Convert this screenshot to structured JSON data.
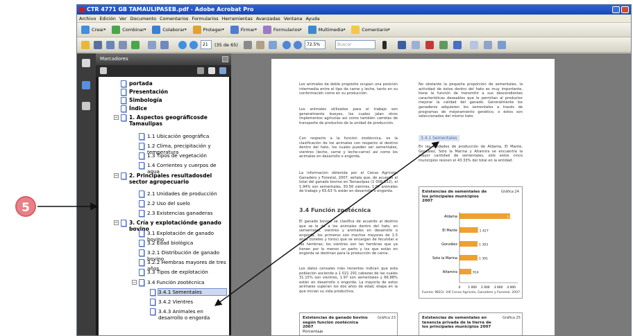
{
  "window": {
    "title": "CTR 4771 GB TAMAULIPASEB.pdf - Adobe Acrobat Pro"
  },
  "menu": [
    "Archivo",
    "Edición",
    "Ver",
    "Documento",
    "Comentarios",
    "Formularios",
    "Herramientas",
    "Avanzadas",
    "Ventana",
    "Ayuda"
  ],
  "toolbar1": [
    {
      "label": "Crear",
      "icon": "create-icon",
      "color": "#3f8fe0"
    },
    {
      "label": "Combinar",
      "icon": "combine-icon",
      "color": "#4aa64a"
    },
    {
      "label": "Colaborar",
      "icon": "collaborate-icon",
      "color": "#3b7fd6"
    },
    {
      "label": "Proteger",
      "icon": "lock-icon",
      "color": "#e2a32c"
    },
    {
      "label": "Firmar",
      "icon": "pen-icon",
      "color": "#4f7bd4"
    },
    {
      "label": "Formularios",
      "icon": "forms-icon",
      "color": "#9b7ac8"
    },
    {
      "label": "Multimedia",
      "icon": "film-icon",
      "color": "#3b8ad2"
    },
    {
      "label": "Comentario",
      "icon": "comment-icon",
      "color": "#f3c93f"
    }
  ],
  "toolbar2": {
    "page_current": "21",
    "page_total": "(35 de 65)",
    "zoom": "72.5%",
    "search_placeholder": "Buscar"
  },
  "bookmarks": {
    "header": "Marcadores",
    "items": [
      {
        "label": "portada",
        "bold": true,
        "level": 0
      },
      {
        "label": "Presentación",
        "bold": true,
        "level": 0
      },
      {
        "label": "Simbología",
        "bold": true,
        "level": 0
      },
      {
        "label": "Índice",
        "bold": true,
        "level": 0
      },
      {
        "label": "1. Aspectos geográficosde Tamaulipas",
        "bold": true,
        "level": 0,
        "expander": "−"
      },
      {
        "label": "1.1 Ubicación geográfica",
        "bold": false,
        "level": 1
      },
      {
        "label": "1.2 Clima, precipitación y temperatura",
        "bold": false,
        "level": 1
      },
      {
        "label": "1.3 Tipos de vegetación",
        "bold": false,
        "level": 1
      },
      {
        "label": "1.4 Corrientes y cuerpos de agua",
        "bold": false,
        "level": 1
      },
      {
        "label": "2. Principales resultadosdel sector agropecuario",
        "bold": true,
        "level": 0,
        "expander": "−"
      },
      {
        "label": "2.1 Unidades de producción",
        "bold": false,
        "level": 1
      },
      {
        "label": "2.2 Uso del suelo",
        "bold": false,
        "level": 1
      },
      {
        "label": "2.3 Existencias ganaderas",
        "bold": false,
        "level": 1
      },
      {
        "label": "3. Cría y explotaciónde ganado bovino",
        "bold": true,
        "level": 0,
        "expander": "−"
      },
      {
        "label": "3.1 Explotación de ganado bovino",
        "bold": false,
        "level": 1
      },
      {
        "label": "3.2 Edad biológica",
        "bold": false,
        "level": 1
      },
      {
        "label": "3.2.1 Distribución de ganado bovino",
        "bold": false,
        "level": 1
      },
      {
        "label": "3.2.2 Hembras mayores de tres años",
        "bold": false,
        "level": 1
      },
      {
        "label": "3.3 Tipos de explotación",
        "bold": false,
        "level": 1
      },
      {
        "label": "3.4 Función zootécnica",
        "bold": false,
        "level": 1,
        "expander": "−"
      },
      {
        "label": "3.4.1 Sementales",
        "bold": false,
        "level": 2,
        "selected": true
      },
      {
        "label": "3.4.2 Vientres",
        "bold": false,
        "level": 2
      },
      {
        "label": "3.4.3 Animales en desarrollo o engorda",
        "bold": false,
        "level": 2
      }
    ]
  },
  "page": {
    "col1_p1": "Los animales de doble propósito ocupan una posición intermedia entre el tipo de carne y leche, tanto en su conformación como en su producción.",
    "col1_p2": "Los animales utilizados para el trabajo son generalmente bueyes, los cuales jalan otros implementos agrícolas así como también carretas de transporte de productos de la unidad de producción.",
    "col1_p3": "Con respecto a la función zootécnica, es la clasificación de los animales con respecto al destino dentro del hato, los cuales pueden ser sementales, vientres (leche, carne y leche-carne) así como los animales en desarrollo o engorda.",
    "col1_p4": "La información obtenida por el Censo Agrícola, Ganadero y Forestal, 2007, señala que, de acuerdo al total del ganado bovino en Tamaulipas (1 008 832), el 1.94% son sementales, 30.56 vientres, 1.87 animales de trabajo y 65.63 % están en desarrollo o engorda.",
    "heading": "3.4 Función zootécnica",
    "col1_p5": "El ganado bovino se clasifica de acuerdo al destino que se le da a los animales dentro del hato, en sementales, vientres y animales en desarrollo o engorda; los primeros son machos mayores de 1.5 años (toretes y toros) que se encargan de fecundar a las hembras; los vientres son las hembras que ya tienen por lo menos un parto y los que están en engorda se destinan para la producción de carne.",
    "col1_p6": "Los datos censales más recientes indican que esta población asciende a 1 021 291 cabezas de las cuales 31.15% son vientres, 1.97 son sementales y 66.88% están en desarrollo o engorda. La mayoría de estos animales superan los dos años de edad, etapa en la que inician su vida productiva.",
    "col2_p1": "No obstante la pequeña proporción de sementales, la actividad de éstos dentro del hato es muy importante, tiene la función de transmitir a sus descendientes características deseables que le permitan al productor mejorar la calidad del ganado. Generalmente los ganaderos adquieren los sementales a través de programas de mejoramiento genético, o éstos son seleccionados del mismo hato.",
    "subsection": "3.4.1 Sementales",
    "col2_p2": "En las unidades de producción de Aldama, El Mante, González, Soto la Marina y Altamira se encuentra la mayor cantidad de sementales, sólo estos cinco municipios reúnen el 43.33% del total en la entidad.",
    "chart24_title": "Existencias de sementales de los principales municipios 2007",
    "chart24_tag": "Gráfica 24",
    "chart24_source": "Fuente: INEGI. VIII Censo Agrícola, Ganadero y Forestal, 2007.",
    "chart23_title": "Existencias de ganado bovino según función zootécnica 2007",
    "chart23_sub": "Porcentaje",
    "chart23_tag": "Gráfica 23",
    "chart25_title": "Existencias de sementales en tenencia privada de la tierra de los principales municipios 2007",
    "chart25_tag": "Gráfica 25"
  },
  "chart_data": {
    "type": "bar",
    "orientation": "horizontal",
    "title": "Existencias de sementales de los principales municipios 2007",
    "categories": [
      "Aldama",
      "El Mante",
      "González",
      "Soto la Marina",
      "Altamira"
    ],
    "values": [
      3900,
      1427,
      1393,
      1391,
      914
    ],
    "value_labels": [
      "3 900",
      "1 427",
      "1 393",
      "1 391",
      "914"
    ],
    "xlim": [
      0,
      4500
    ],
    "xticks": [
      0,
      1000,
      2000,
      3000,
      4000
    ],
    "xtick_labels": [
      "0",
      "1 000",
      "2 000",
      "3 000",
      "4 000"
    ],
    "bar_color": "#f0a030"
  },
  "callout": {
    "number": "5"
  }
}
